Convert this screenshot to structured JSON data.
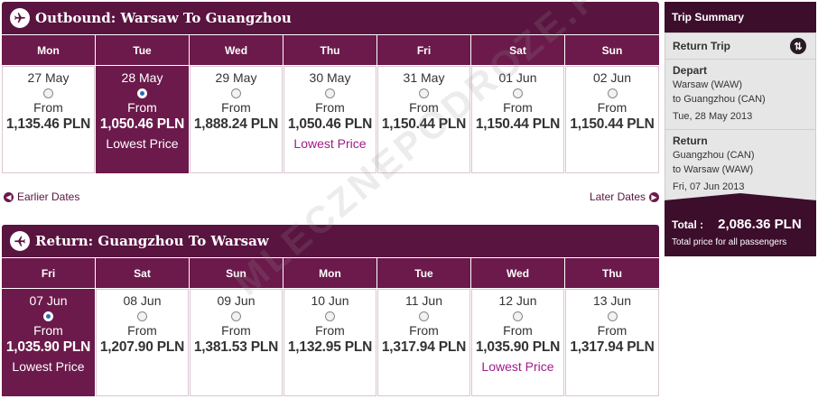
{
  "outbound": {
    "title": "Outbound: Warsaw To Guangzhou",
    "days": [
      "Mon",
      "Tue",
      "Wed",
      "Thu",
      "Fri",
      "Sat",
      "Sun"
    ],
    "fares": [
      {
        "date": "27 May",
        "from": "From",
        "price": "1,135.46 PLN",
        "note": "",
        "selected": false
      },
      {
        "date": "28 May",
        "from": "From",
        "price": "1,050.46 PLN",
        "note": "Lowest Price",
        "selected": true
      },
      {
        "date": "29 May",
        "from": "From",
        "price": "1,888.24 PLN",
        "note": "",
        "selected": false
      },
      {
        "date": "30 May",
        "from": "From",
        "price": "1,050.46 PLN",
        "note": "Lowest Price",
        "selected": false
      },
      {
        "date": "31 May",
        "from": "From",
        "price": "1,150.44 PLN",
        "note": "",
        "selected": false
      },
      {
        "date": "01 Jun",
        "from": "From",
        "price": "1,150.44 PLN",
        "note": "",
        "selected": false
      },
      {
        "date": "02 Jun",
        "from": "From",
        "price": "1,150.44 PLN",
        "note": "",
        "selected": false
      }
    ],
    "earlier_label": "Earlier Dates",
    "later_label": "Later Dates"
  },
  "return": {
    "title": "Return: Guangzhou To Warsaw",
    "days": [
      "Fri",
      "Sat",
      "Sun",
      "Mon",
      "Tue",
      "Wed",
      "Thu"
    ],
    "fares": [
      {
        "date": "07 Jun",
        "from": "From",
        "price": "1,035.90 PLN",
        "note": "Lowest Price",
        "selected": true
      },
      {
        "date": "08 Jun",
        "from": "From",
        "price": "1,207.90 PLN",
        "note": "",
        "selected": false
      },
      {
        "date": "09 Jun",
        "from": "From",
        "price": "1,381.53 PLN",
        "note": "",
        "selected": false
      },
      {
        "date": "10 Jun",
        "from": "From",
        "price": "1,132.95 PLN",
        "note": "",
        "selected": false
      },
      {
        "date": "11 Jun",
        "from": "From",
        "price": "1,317.94 PLN",
        "note": "",
        "selected": false
      },
      {
        "date": "12 Jun",
        "from": "From",
        "price": "1,035.90 PLN",
        "note": "Lowest Price",
        "selected": false
      },
      {
        "date": "13 Jun",
        "from": "From",
        "price": "1,317.94 PLN",
        "note": "",
        "selected": false
      }
    ]
  },
  "summary": {
    "title": "Trip Summary",
    "trip_type": "Return Trip",
    "depart": {
      "label": "Depart",
      "from": "Warsaw (WAW)",
      "to": "to Guangzhou (CAN)",
      "date": "Tue, 28 May 2013"
    },
    "return": {
      "label": "Return",
      "from": "Guangzhou (CAN)",
      "to": "to Warsaw (WAW)",
      "date": "Fri, 07 Jun 2013"
    },
    "total_label": "Total :",
    "total_value": "2,086.36 PLN",
    "total_note": "Total price for all passengers"
  },
  "watermark": "MLECZNEPODROZE.PL",
  "colors": {
    "plum": "#6b1a4b",
    "dark_plum": "#3c0e2b",
    "lowest_text": "#a01b8a"
  }
}
